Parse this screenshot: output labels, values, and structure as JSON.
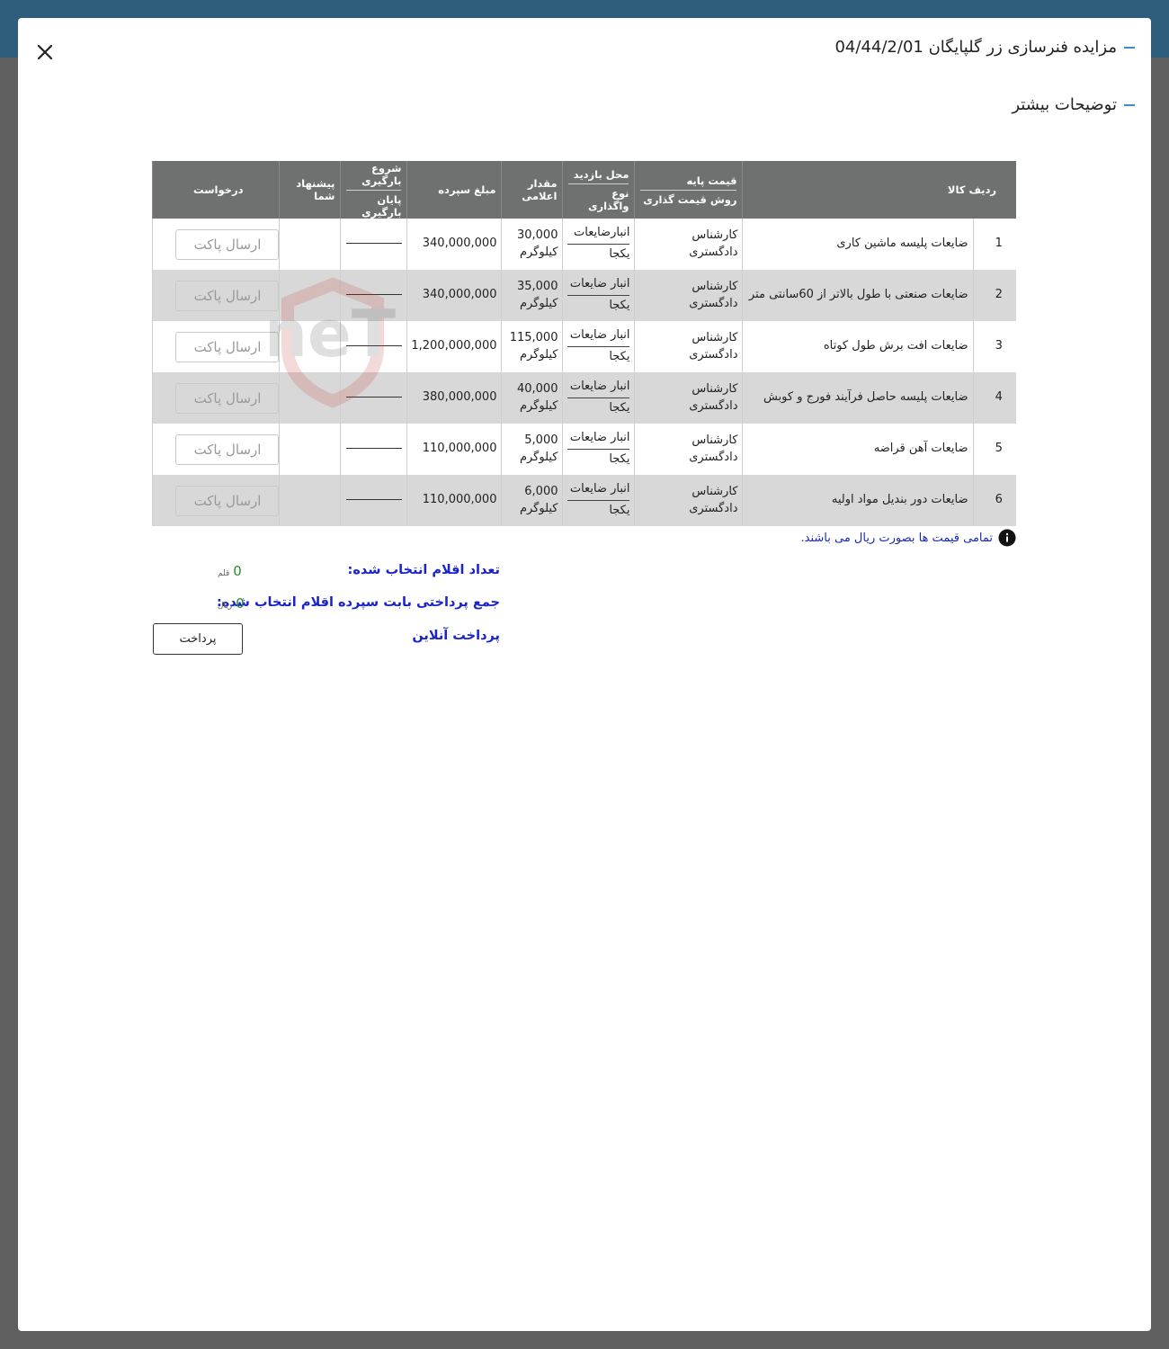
{
  "modal": {
    "title": "مزایده فنرسازی زر گلپایگان 04/44/2/01",
    "subtitle": "توضیحات بیشتر"
  },
  "table": {
    "headers": {
      "row_item": "ردیف کالا",
      "base_price": "قیمت پایه",
      "pricing_method": "روش قیمت گذاری",
      "visit_location": "محل بازدید",
      "transfer_type": "نوع واگذاری",
      "declared_qty": "مقدار اعلامی",
      "deposit": "مبلغ سپرده",
      "load_start": "شروع بارگیری",
      "load_end": "پایان بارگیری",
      "your_offer": "پیشنهاد شما",
      "request": "درخواست"
    },
    "rows": [
      {
        "no": "1",
        "name": "ضایعات پلیسه ماشین کاری",
        "method": "کارشناس دادگستری",
        "location": "انبارضایعات",
        "transfer": "یکجا",
        "qty": "30,000",
        "unit": "کیلوگرم",
        "deposit": "340,000,000",
        "button": "ارسال پاکت"
      },
      {
        "no": "2",
        "name": "ضایعات صنعتی با طول بالاتر از 60سانتی متر",
        "method": "کارشناس دادگستری",
        "location": "انبار ضایعات",
        "transfer": "یکجا",
        "qty": "35,000",
        "unit": "کیلوگرم",
        "deposit": "340,000,000",
        "button": "ارسال پاکت"
      },
      {
        "no": "3",
        "name": "ضایعات افت برش طول کوتاه",
        "method": "کارشناس دادگستری",
        "location": "انبار ضایعات",
        "transfer": "یکجا",
        "qty": "115,000",
        "unit": "کیلوگرم",
        "deposit": "1,200,000,000",
        "button": "ارسال پاکت"
      },
      {
        "no": "4",
        "name": "ضایعات پلیسه حاصل فرآیند فورج و کوبش",
        "method": "کارشناس دادگستری",
        "location": "انبار ضایعات",
        "transfer": "یکجا",
        "qty": "40,000",
        "unit": "کیلوگرم",
        "deposit": "380,000,000",
        "button": "ارسال پاکت"
      },
      {
        "no": "5",
        "name": "ضایعات آهن قراضه",
        "method": "کارشناس دادگستری",
        "location": "انبار ضایعات",
        "transfer": "یکجا",
        "qty": "5,000",
        "unit": "کیلوگرم",
        "deposit": "110,000,000",
        "button": "ارسال پاکت"
      },
      {
        "no": "6",
        "name": "ضایعات دور بندیل مواد اولیه",
        "method": "کارشناس دادگستری",
        "location": "انبار ضایعات",
        "transfer": "یکجا",
        "qty": "6,000",
        "unit": "کیلوگرم",
        "deposit": "110,000,000",
        "button": "ارسال پاکت"
      }
    ]
  },
  "note": "تمامی قیمت ها بصورت ریال می باشند.",
  "summary": {
    "selected_count_label": "تعداد اقلام انتخاب شده:",
    "selected_count_value": "0",
    "selected_count_unit": "قلم",
    "total_label": "جمع پرداختی بابت سپرده اقلام انتخاب شده:",
    "total_value": "0",
    "total_unit": "ریال",
    "online_payment_label": "پرداخت آنلاین",
    "pay_button": "پرداخت"
  },
  "watermark_text": "AriaTender.neT",
  "colors": {
    "header_bg": "#6f7070",
    "accent_dash": "#3a8fd6",
    "summary_label": "#1a24c8",
    "summary_value": "#2a8a2a",
    "watermark": "#c0392b"
  },
  "icons": {
    "close": "close-icon",
    "info": "info-icon"
  }
}
